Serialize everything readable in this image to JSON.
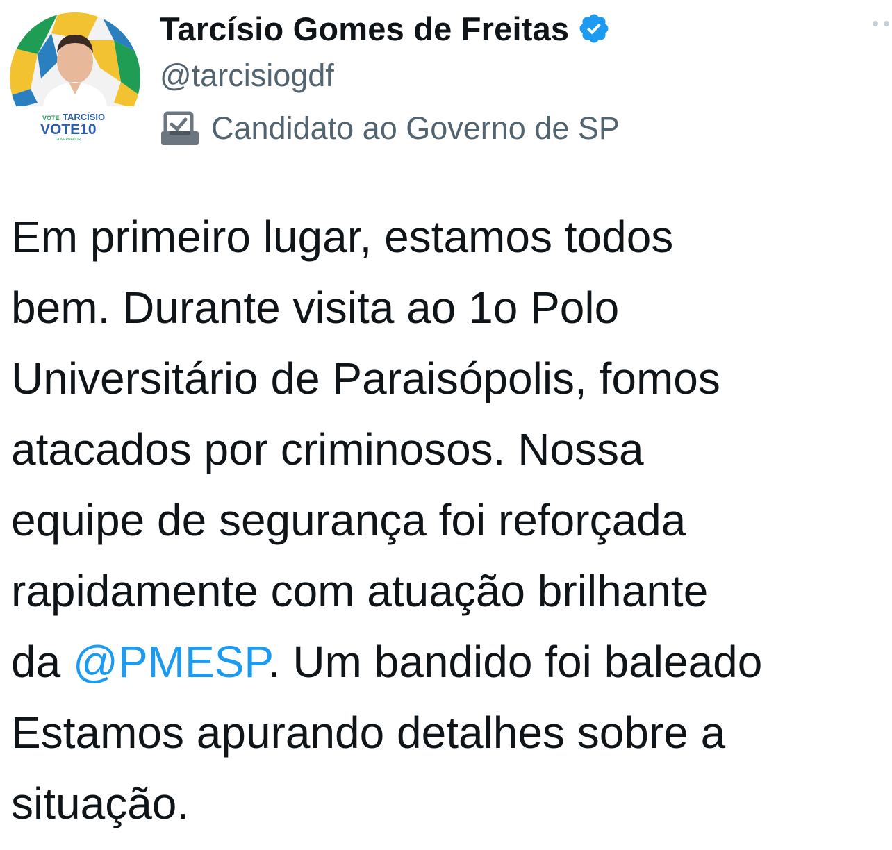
{
  "author": {
    "display_name": "Tarcísio Gomes de Freitas",
    "verified": true,
    "handle": "@tarcisiogdf",
    "bio_icon": "ballot-box-icon",
    "bio": "Candidato ao Governo de SP"
  },
  "avatar": {
    "line1_prefix": "VOTE",
    "line1": "TARCÍSIO",
    "line2": "VOTE10",
    "line3": "GOVERNADOR"
  },
  "tweet": {
    "lines": [
      "Em primeiro lugar, estamos todos",
      "bem. Durante visita ao 1o Polo",
      "Universitário de Paraisópolis, fomos",
      "atacados por criminosos. Nossa",
      "equipe de segurança foi reforçada",
      "rapidamente com atuação brilhante"
    ],
    "line7_before": "da ",
    "mention": "@PMESP",
    "line7_after": ". Um bandido foi baleado",
    "lines_after": [
      "Estamos apurando detalhes sobre a",
      "situação."
    ]
  },
  "colors": {
    "link": "#1d9bf0",
    "secondary_text": "#536471",
    "verified_badge": "#1d9bf0"
  }
}
